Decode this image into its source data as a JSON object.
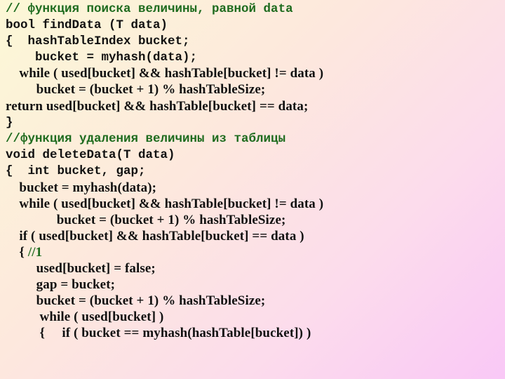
{
  "code": {
    "lines": [
      {
        "text": "// функция поиска величины, равной data",
        "type": "comment"
      },
      {
        "text": "bool findData (T data)",
        "type": "code"
      },
      {
        "text": "{  hashTableIndex bucket;",
        "type": "code"
      },
      {
        "text": "    bucket = myhash(data);",
        "type": "code"
      },
      {
        "text": "    while ( used[bucket] && hashTable[bucket] != data )",
        "type": "code"
      },
      {
        "text": "         bucket = (bucket + 1) % hashTableSize;",
        "type": "code"
      },
      {
        "text": "return used[bucket] && hashTable[bucket] == data;",
        "type": "code"
      },
      {
        "text": "}",
        "type": "code"
      },
      {
        "text": "//функция удаления величины из таблицы",
        "type": "comment"
      },
      {
        "text": "void deleteData(T data)",
        "type": "code"
      },
      {
        "text": "{  int bucket, gap;",
        "type": "code"
      },
      {
        "text": "    bucket = myhash(data);",
        "type": "code"
      },
      {
        "text": "    while ( used[bucket] && hashTable[bucket] != data )",
        "type": "code"
      },
      {
        "text": "               bucket = (bucket + 1) % hashTableSize;",
        "type": "code"
      },
      {
        "text": "    if ( used[bucket] && hashTable[bucket] == data )",
        "type": "code"
      },
      {
        "text": "    { ",
        "type": "code",
        "comment_suffix": "//1"
      },
      {
        "text": "         used[bucket] = false;",
        "type": "code"
      },
      {
        "text": "         gap = bucket;",
        "type": "code"
      },
      {
        "text": "         bucket = (bucket + 1) % hashTableSize;",
        "type": "code"
      },
      {
        "text": "          while ( used[bucket] )",
        "type": "code"
      },
      {
        "text": "          {     if ( bucket == myhash(hashTable[bucket]) )",
        "type": "code"
      }
    ]
  },
  "colors": {
    "code": "#111111",
    "comment": "#1e6b1e"
  }
}
